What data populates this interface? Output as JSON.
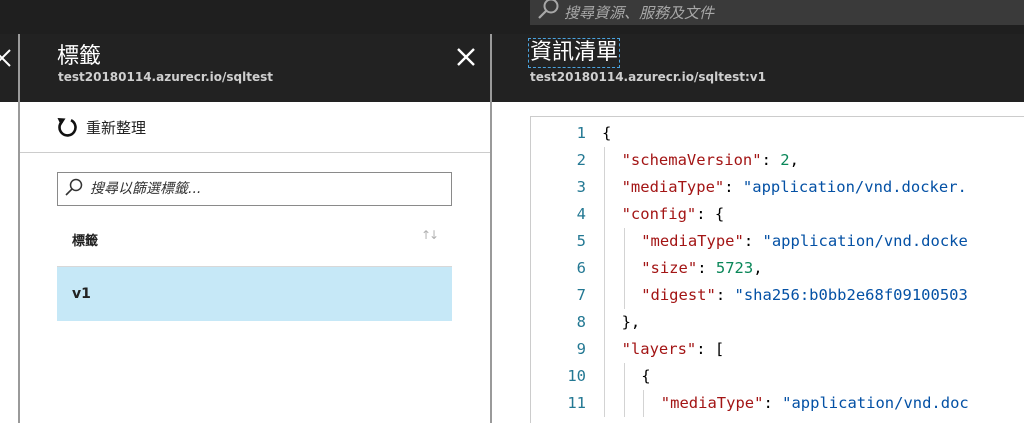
{
  "topbar": {
    "search_placeholder": "搜尋資源、服務及文件"
  },
  "tags_blade": {
    "title": "標籤",
    "subtitle": "test20180114.azurecr.io/sqltest",
    "refresh_label": "重新整理",
    "filter_placeholder": "搜尋以篩選標籤...",
    "column_header": "標籤",
    "sort_icon": "↑↓",
    "rows": [
      "v1"
    ]
  },
  "manifest_blade": {
    "title": "資訊清單",
    "subtitle": "test20180114.azurecr.io/sqltest:v1"
  },
  "manifest_code": [
    {
      "n": "1",
      "indent": 0,
      "tokens": [
        [
          "p",
          "{"
        ]
      ]
    },
    {
      "n": "2",
      "indent": 1,
      "tokens": [
        [
          "k",
          "\"schemaVersion\""
        ],
        [
          "p",
          ": "
        ],
        [
          "n",
          "2"
        ],
        [
          "p",
          ","
        ]
      ]
    },
    {
      "n": "3",
      "indent": 1,
      "tokens": [
        [
          "k",
          "\"mediaType\""
        ],
        [
          "p",
          ": "
        ],
        [
          "s",
          "\"application/vnd.docker."
        ]
      ]
    },
    {
      "n": "4",
      "indent": 1,
      "tokens": [
        [
          "k",
          "\"config\""
        ],
        [
          "p",
          ": {"
        ]
      ]
    },
    {
      "n": "5",
      "indent": 2,
      "tokens": [
        [
          "k",
          "\"mediaType\""
        ],
        [
          "p",
          ": "
        ],
        [
          "s",
          "\"application/vnd.docke"
        ]
      ]
    },
    {
      "n": "6",
      "indent": 2,
      "tokens": [
        [
          "k",
          "\"size\""
        ],
        [
          "p",
          ": "
        ],
        [
          "n",
          "5723"
        ],
        [
          "p",
          ","
        ]
      ]
    },
    {
      "n": "7",
      "indent": 2,
      "tokens": [
        [
          "k",
          "\"digest\""
        ],
        [
          "p",
          ": "
        ],
        [
          "s",
          "\"sha256:b0bb2e68f09100503"
        ]
      ]
    },
    {
      "n": "8",
      "indent": 1,
      "tokens": [
        [
          "p",
          "},"
        ]
      ]
    },
    {
      "n": "9",
      "indent": 1,
      "tokens": [
        [
          "k",
          "\"layers\""
        ],
        [
          "p",
          ": ["
        ]
      ]
    },
    {
      "n": "10",
      "indent": 2,
      "tokens": [
        [
          "p",
          "{"
        ]
      ]
    },
    {
      "n": "11",
      "indent": 3,
      "tokens": [
        [
          "k",
          "\"mediaType\""
        ],
        [
          "p",
          ": "
        ],
        [
          "s",
          "\"application/vnd.doc"
        ]
      ]
    }
  ],
  "colors": {
    "chrome_dark": "#1f1f1f",
    "blade_header": "#222222",
    "selected_row": "#c6e8f7",
    "json_key": "#a31515",
    "json_string": "#0451a5",
    "json_number": "#098658",
    "line_number": "#237893"
  }
}
